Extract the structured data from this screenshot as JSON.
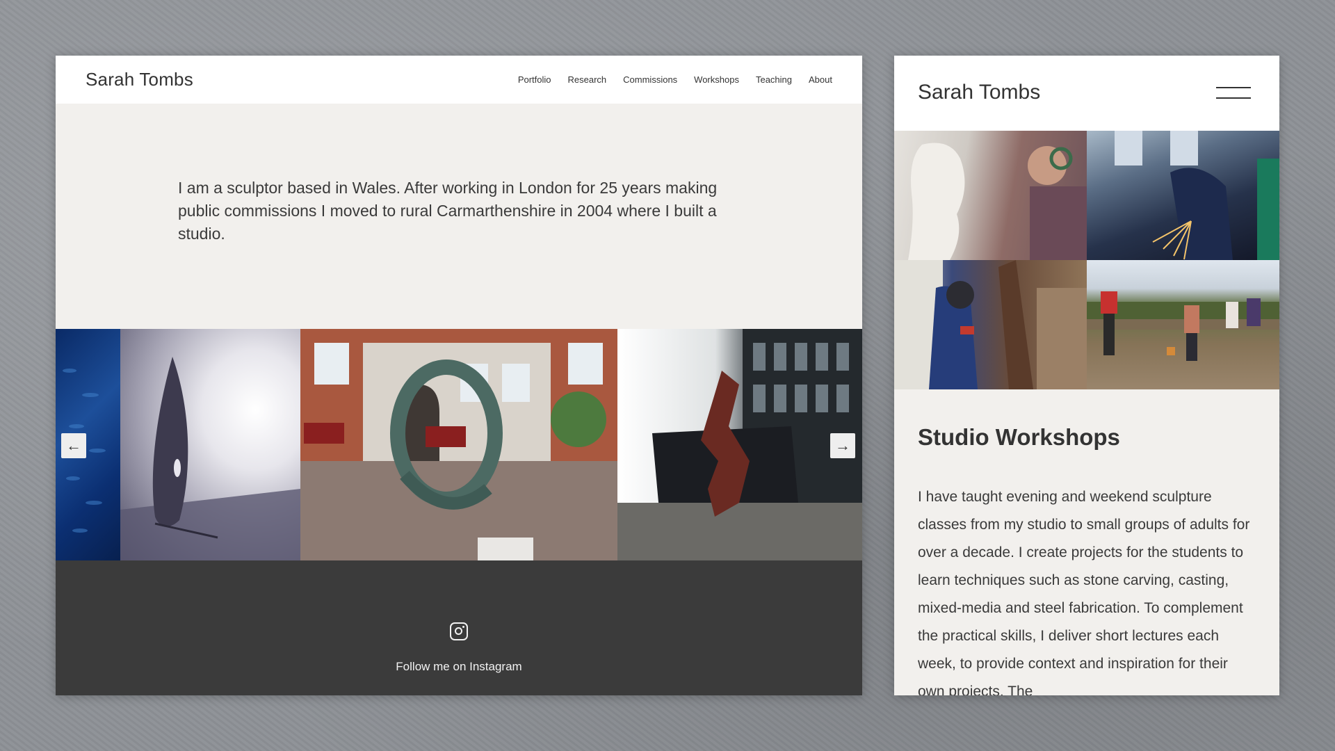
{
  "desktop": {
    "logo": "Sarah Tombs",
    "nav": [
      "Portfolio",
      "Research",
      "Commissions",
      "Workshops",
      "Teaching",
      "About"
    ],
    "intro": "I am a sculptor based in Wales.  After working in London for 25 years making public commissions I moved to rural Carmarthenshire in 2004 where I built a studio.",
    "carousel": {
      "prev_arrow": "←",
      "next_arrow": "→"
    },
    "footer": {
      "instagram_icon": "instagram-icon",
      "follow_text": "Follow me on Instagram"
    }
  },
  "mobile": {
    "logo": "Sarah Tombs",
    "menu_icon": "hamburger-menu-icon",
    "section_title": "Studio Workshops",
    "body": "I have taught evening and weekend sculpture classes from my studio to small groups of adults for over a decade. I create projects for the students to learn techniques such as stone carving, casting, mixed-media and steel fabrication. To complement the practical skills, I deliver short lectures each week, to provide context and inspiration for their own projects. The"
  }
}
